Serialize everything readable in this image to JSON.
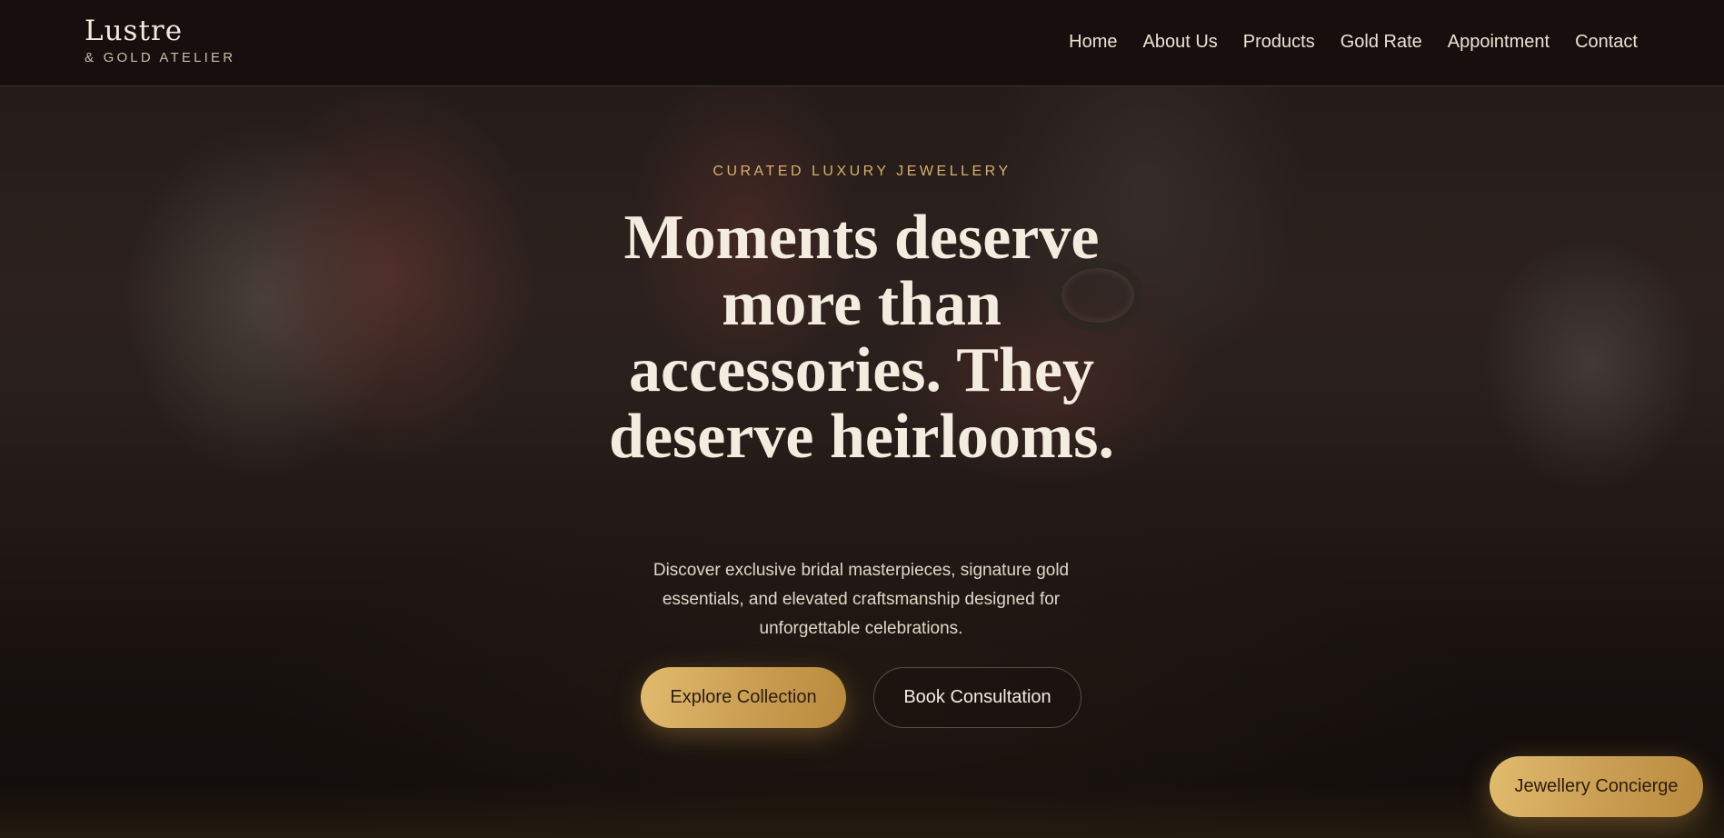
{
  "brand": {
    "name": "Lustre",
    "tagline": "& GOLD ATELIER"
  },
  "nav": {
    "items": [
      {
        "label": "Home"
      },
      {
        "label": "About Us"
      },
      {
        "label": "Products"
      },
      {
        "label": "Gold Rate"
      },
      {
        "label": "Appointment"
      },
      {
        "label": "Contact"
      }
    ]
  },
  "hero": {
    "eyebrow": "CURATED LUXURY JEWELLERY",
    "headline": "Moments deserve more than accessories. They deserve heirlooms.",
    "subtext": "Discover exclusive bridal masterpieces, signature gold essentials, and elevated craftsmanship designed for unforgettable celebrations.",
    "primary_cta": "Explore Collection",
    "secondary_cta": "Book Consultation"
  },
  "concierge": {
    "label": "Jewellery Concierge"
  },
  "colors": {
    "gold_accent": "#d9b06a",
    "button_gold": "#c99d52",
    "header_bg": "#170f0e",
    "text_light": "#f4ecdf"
  }
}
